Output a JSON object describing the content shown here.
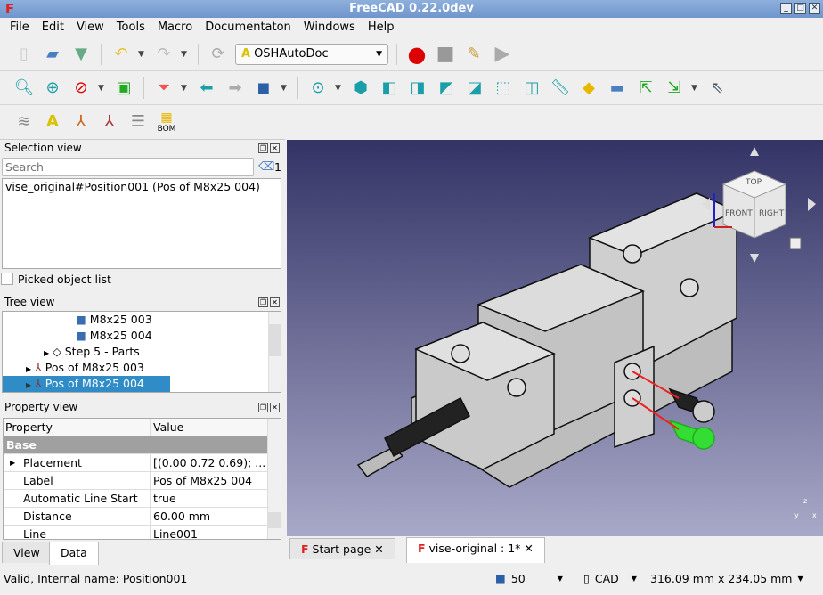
{
  "window": {
    "title": "FreeCAD 0.22.0dev"
  },
  "menu": [
    "File",
    "Edit",
    "View",
    "Tools",
    "Macro",
    "Documentaton",
    "Windows",
    "Help"
  ],
  "toolbar": {
    "workbench": "OSHAutoDoc",
    "bom_label": "BOM"
  },
  "selection_view": {
    "title": "Selection view",
    "search_placeholder": "Search",
    "count": "1",
    "items": [
      "vise_original#Position001 (Pos of M8x25 004)"
    ],
    "picked_label": "Picked object list"
  },
  "tree_view": {
    "title": "Tree view",
    "items": [
      {
        "label": "M8x25 003",
        "icon": "part-icon"
      },
      {
        "label": "M8x25 004",
        "icon": "part-icon"
      },
      {
        "label": "Step 5 - Parts",
        "icon": "group-icon"
      },
      {
        "label": "Pos of M8x25 003",
        "icon": "position-icon"
      },
      {
        "label": "Pos of M8x25 004",
        "icon": "position-icon",
        "selected": true
      }
    ]
  },
  "property_view": {
    "title": "Property view",
    "col_property": "Property",
    "col_value": "Value",
    "group": "Base",
    "rows": [
      {
        "k": "Placement",
        "v": "[(0.00 0.72 0.69); ..."
      },
      {
        "k": "Label",
        "v": "Pos of M8x25 004"
      },
      {
        "k": "Automatic Line Start",
        "v": "true"
      },
      {
        "k": "Distance",
        "v": "60.00 mm"
      },
      {
        "k": "Line",
        "v": "Line001"
      }
    ],
    "tabs": [
      "View",
      "Data"
    ],
    "active_tab": "Data"
  },
  "navcube": {
    "top": "TOP",
    "front": "FRONT",
    "right": "RIGHT"
  },
  "doc_tabs": [
    {
      "label": "Start page"
    },
    {
      "label": "vise-original : 1*",
      "active": true
    }
  ],
  "status": {
    "message": "Valid, Internal name: Position001",
    "cache": "50",
    "nav_style": "CAD",
    "dimensions": "316.09 mm x 234.05 mm"
  },
  "colors": {
    "selection": "#308cc6",
    "viewport_top": "#333366",
    "viewport_bottom": "#a8a8c8",
    "highlight": "#33dd33"
  }
}
